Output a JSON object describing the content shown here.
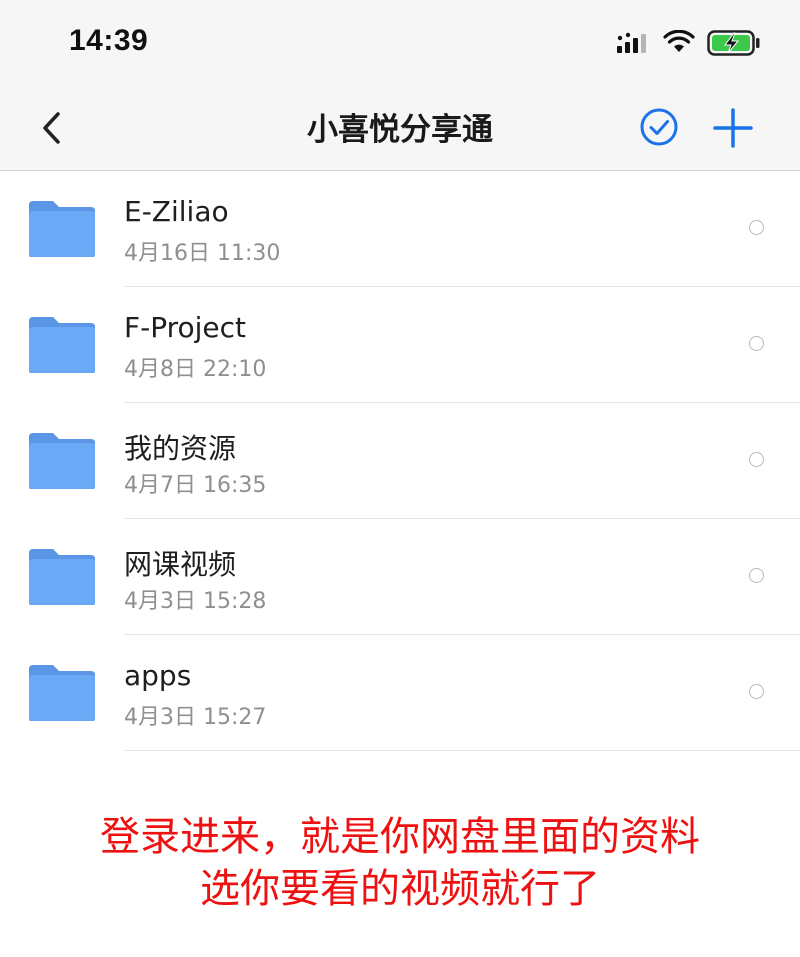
{
  "status_bar": {
    "time": "14:39",
    "icons": [
      "signal-icon",
      "wifi-icon",
      "battery-charging-icon"
    ]
  },
  "nav": {
    "title": "小喜悦分享通",
    "back_icon": "chevron-left-icon",
    "select_icon": "check-circle-icon",
    "add_icon": "plus-icon"
  },
  "files": [
    {
      "name": "E-Ziliao",
      "date": "4月16日 11:30",
      "icon": "folder-icon"
    },
    {
      "name": "F-Project",
      "date": "4月8日 22:10",
      "icon": "folder-icon"
    },
    {
      "name": "我的资源",
      "date": "4月7日 16:35",
      "icon": "folder-icon"
    },
    {
      "name": "网课视频",
      "date": "4月3日 15:28",
      "icon": "folder-icon"
    },
    {
      "name": "apps",
      "date": "4月3日 15:27",
      "icon": "folder-icon"
    }
  ],
  "caption": {
    "line1": "登录进来，就是你网盘里面的资料",
    "line2": "选你要看的视频就行了"
  },
  "colors": {
    "accent": "#1a73e8",
    "folder": "#6aa9f5",
    "folder_tab": "#5b96e6",
    "caption": "#ee1111",
    "battery_fill": "#3cc84a"
  }
}
